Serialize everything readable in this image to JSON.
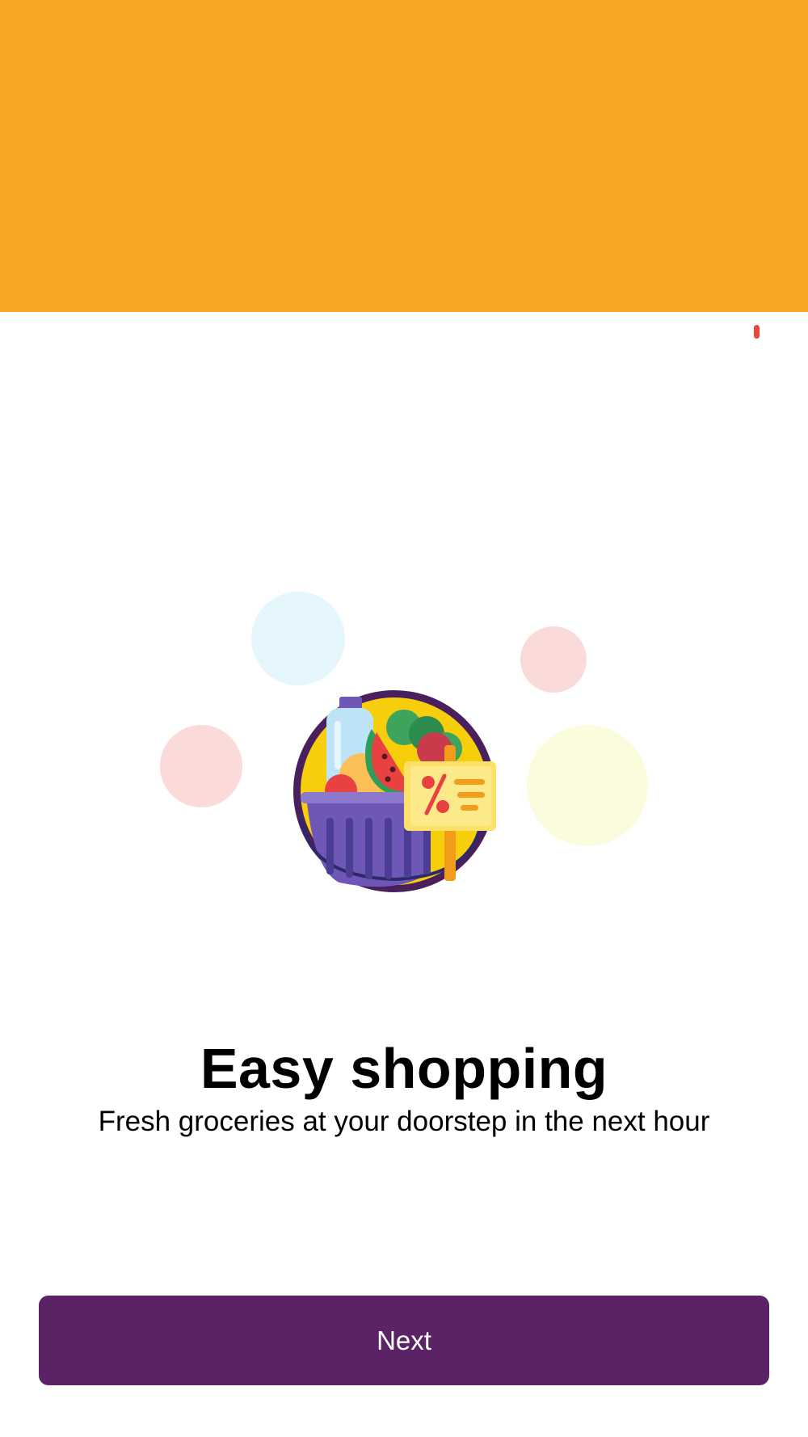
{
  "colors": {
    "banner": "#F8A724",
    "indicator": "#F04438",
    "button": "#5C2266",
    "bubble_blue": "#E6F6FD",
    "bubble_pink": "#FBDADA",
    "bubble_yellow": "#FBFCDD"
  },
  "onboarding": {
    "illustration_icon": "grocery-basket-icon",
    "title": "Easy shopping",
    "subtitle": "Fresh groceries at your doorstep in the next hour"
  },
  "actions": {
    "next_label": "Next"
  }
}
